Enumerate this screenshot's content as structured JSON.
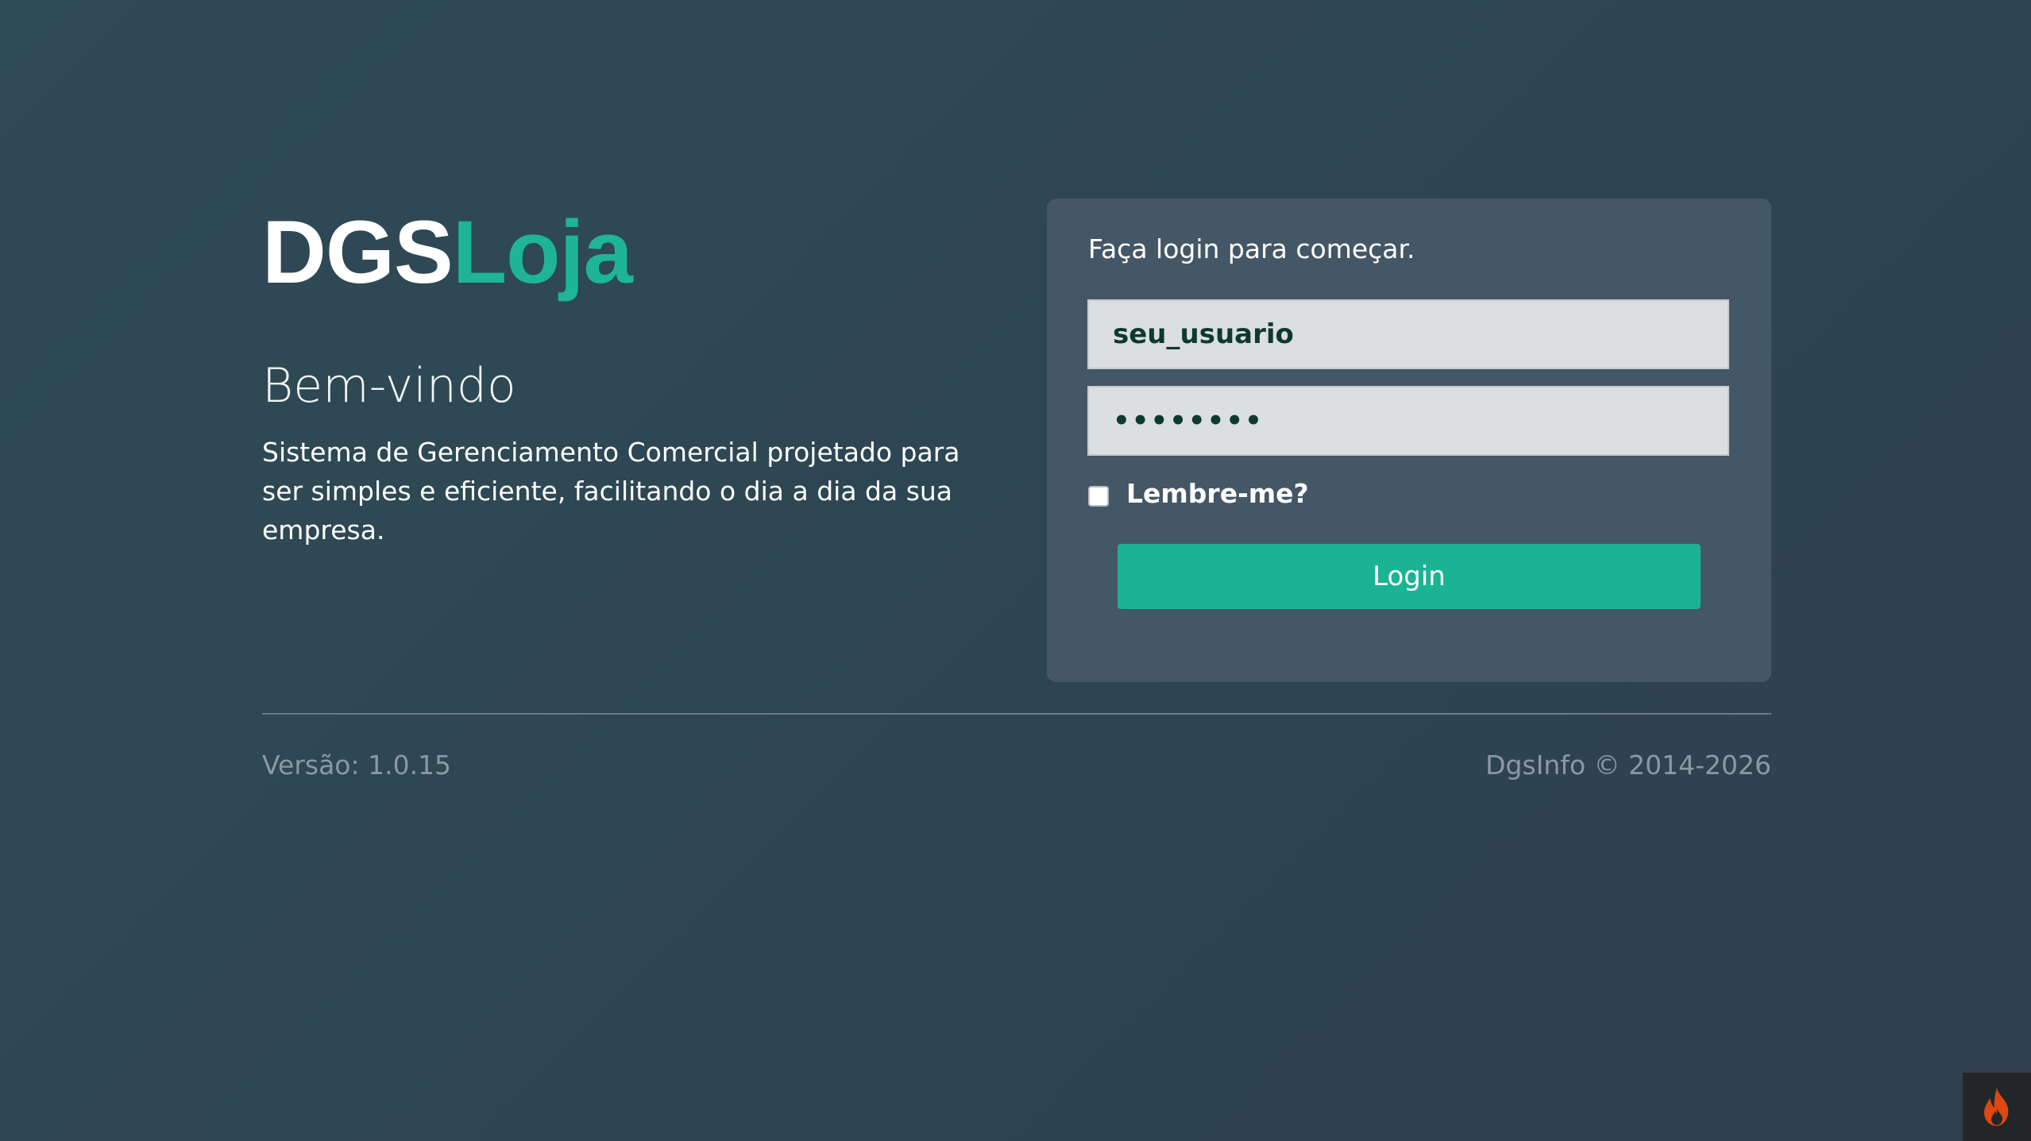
{
  "logo": {
    "part1": "DGS",
    "part2": "Loja"
  },
  "welcome": {
    "title": "Bem-vindo",
    "description": "Sistema de Gerenciamento Comercial projetado para ser simples e eficiente, facilitando o dia a dia da sua empresa."
  },
  "login_box": {
    "message": "Faça login para começar.",
    "username_value": "seu_usuario",
    "password_value": "••••••••",
    "remember_label": "Lembre-me?",
    "remember_checked": false,
    "login_button_label": "Login"
  },
  "footer": {
    "version": "Versão: 1.0.15",
    "copyright": "DgsInfo © 2014-2026"
  },
  "debug_toolbar": {
    "icon": "flame-icon"
  },
  "colors": {
    "accent": "#1ab394",
    "box_background": "#445766",
    "page_background": "#2e4552"
  }
}
